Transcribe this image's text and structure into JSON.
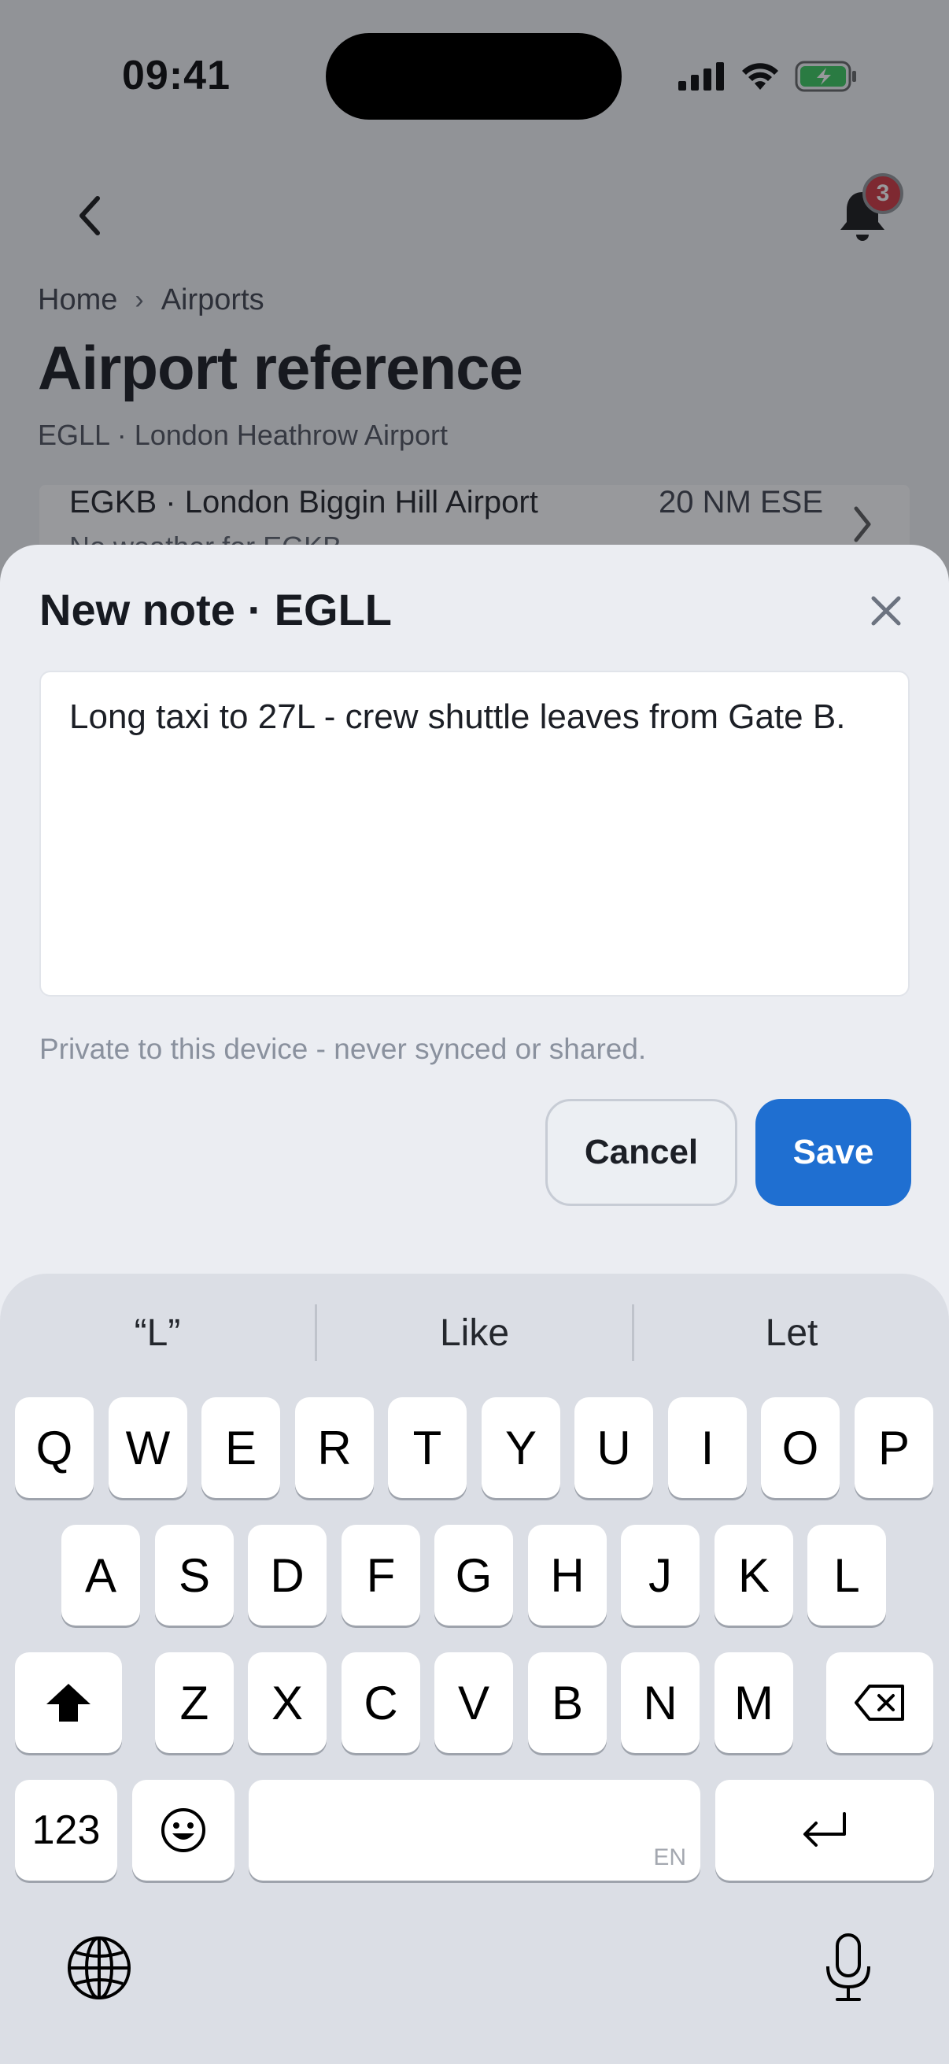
{
  "status_bar": {
    "time": "09:41"
  },
  "nav": {
    "notification_count": "3"
  },
  "breadcrumb": {
    "home": "Home",
    "separator": "›",
    "current": "Airports"
  },
  "page": {
    "title": "Airport reference",
    "subtitle": "EGLL · London Heathrow Airport",
    "row": {
      "name": "EGKB · London Biggin Hill Airport",
      "distance": "20 NM ESE",
      "weather": "No weather for EGKB"
    }
  },
  "sheet": {
    "title": "New note · EGLL",
    "note_text": "Long taxi to 27L - crew shuttle leaves from Gate B.",
    "hint": "Private to this device - never synced or shared.",
    "cancel_label": "Cancel",
    "save_label": "Save"
  },
  "keyboard": {
    "suggestions": [
      "“L”",
      "Like",
      "Let"
    ],
    "row1": [
      "Q",
      "W",
      "E",
      "R",
      "T",
      "Y",
      "U",
      "I",
      "O",
      "P"
    ],
    "row2": [
      "A",
      "S",
      "D",
      "F",
      "G",
      "H",
      "J",
      "K",
      "L"
    ],
    "row3": [
      "Z",
      "X",
      "C",
      "V",
      "B",
      "N",
      "M"
    ],
    "numbers_label": "123",
    "space_lang": "EN"
  },
  "colors": {
    "accent": "#1f6fd1",
    "badge": "#d0313a",
    "battery": "#35c759"
  },
  "icons": [
    "back-chevron-icon",
    "bell-icon",
    "close-icon",
    "shift-icon",
    "delete-icon",
    "emoji-icon",
    "return-icon",
    "globe-icon",
    "microphone-icon",
    "signal-icon",
    "wifi-icon",
    "battery-icon"
  ]
}
